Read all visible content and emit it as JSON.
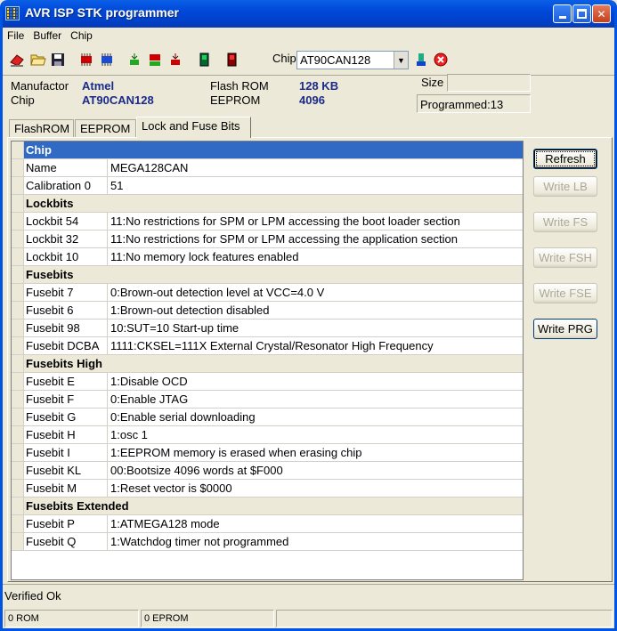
{
  "window": {
    "title": "AVR ISP STK programmer"
  },
  "menu": [
    "File",
    "Buffer",
    "Chip"
  ],
  "toolbar": {
    "chip_label": "Chip",
    "chip_value": "AT90CAN128"
  },
  "info": {
    "manufacturer_label": "Manufactor",
    "manufacturer_value": "Atmel",
    "chip_label": "Chip",
    "chip_value": "AT90CAN128",
    "flash_label": "Flash ROM",
    "flash_value": "128 KB",
    "eeprom_label": "EEPROM",
    "eeprom_value": "4096",
    "size_label": "Size",
    "size_value": "",
    "programmed": "Programmed:13"
  },
  "tabs": [
    "FlashROM",
    "EEPROM",
    "Lock and Fuse Bits"
  ],
  "grid": [
    {
      "type": "head",
      "name": "Chip",
      "value": ""
    },
    {
      "type": "row",
      "name": "Name",
      "value": "MEGA128CAN"
    },
    {
      "type": "row",
      "name": "Calibration 0",
      "value": "51"
    },
    {
      "type": "head",
      "name": "Lockbits",
      "value": ""
    },
    {
      "type": "row",
      "name": "Lockbit 54",
      "value": "11:No restrictions for SPM or LPM accessing the boot loader section"
    },
    {
      "type": "row",
      "name": "Lockbit 32",
      "value": "11:No restrictions for SPM or LPM accessing the application section"
    },
    {
      "type": "row",
      "name": "Lockbit 10",
      "value": "11:No memory lock features enabled"
    },
    {
      "type": "head",
      "name": "Fusebits",
      "value": ""
    },
    {
      "type": "row",
      "name": "Fusebit 7",
      "value": "0:Brown-out detection level at VCC=4.0 V"
    },
    {
      "type": "row",
      "name": "Fusebit 6",
      "value": "1:Brown-out detection disabled"
    },
    {
      "type": "row",
      "name": "Fusebit 98",
      "value": "10:SUT=10 Start-up time"
    },
    {
      "type": "row",
      "name": "Fusebit DCBA",
      "value": "1111:CKSEL=111X External Crystal/Resonator High Frequency"
    },
    {
      "type": "head",
      "name": "Fusebits High",
      "value": ""
    },
    {
      "type": "row",
      "name": "Fusebit E",
      "value": "1:Disable OCD"
    },
    {
      "type": "row",
      "name": "Fusebit F",
      "value": "0:Enable JTAG"
    },
    {
      "type": "row",
      "name": "Fusebit G",
      "value": "0:Enable serial downloading"
    },
    {
      "type": "row",
      "name": "Fusebit H",
      "value": "1:osc 1"
    },
    {
      "type": "row",
      "name": "Fusebit I",
      "value": "1:EEPROM memory is erased when erasing chip"
    },
    {
      "type": "row",
      "name": "Fusebit KL",
      "value": "00:Bootsize 4096 words at $F000"
    },
    {
      "type": "row",
      "name": "Fusebit M",
      "value": "1:Reset vector is $0000"
    },
    {
      "type": "head",
      "name": "Fusebits Extended",
      "value": ""
    },
    {
      "type": "row",
      "name": "Fusebit P",
      "value": "1:ATMEGA128 mode"
    },
    {
      "type": "row",
      "name": "Fusebit Q",
      "value": "1:Watchdog timer not programmed"
    }
  ],
  "buttons": {
    "refresh": "Refresh",
    "write_lb": "Write LB",
    "write_fs": "Write FS",
    "write_fsh": "Write FSH",
    "write_fse": "Write FSE",
    "write_prg": "Write PRG"
  },
  "status": "Verified Ok",
  "statusbar": {
    "rom": "0 ROM",
    "eprom": "0 EPROM"
  }
}
